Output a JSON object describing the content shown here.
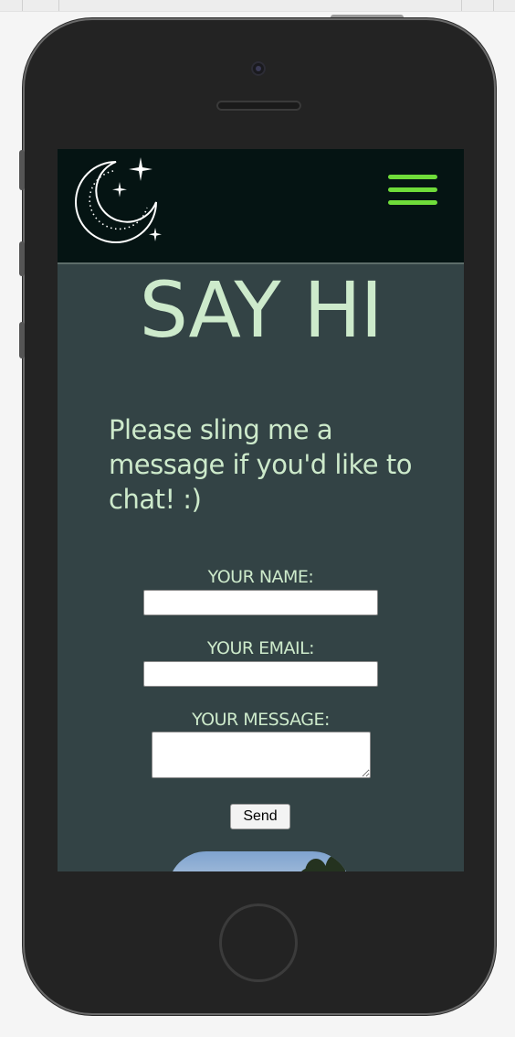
{
  "header": {
    "logo_icon": "moon-stars-icon",
    "menu_icon": "hamburger-menu-icon",
    "accent_color": "#6fdc3a"
  },
  "page": {
    "title": "SAY HI",
    "intro": "Please sling me a message if you'd like to chat! :)"
  },
  "form": {
    "name_label": "YOUR NAME:",
    "name_value": "",
    "email_label": "YOUR EMAIL:",
    "email_value": "",
    "message_label": "YOUR MESSAGE:",
    "message_value": "",
    "send_label": "Send"
  },
  "colors": {
    "background": "#334345",
    "navbar": "#051413",
    "text": "#cdeacb"
  }
}
